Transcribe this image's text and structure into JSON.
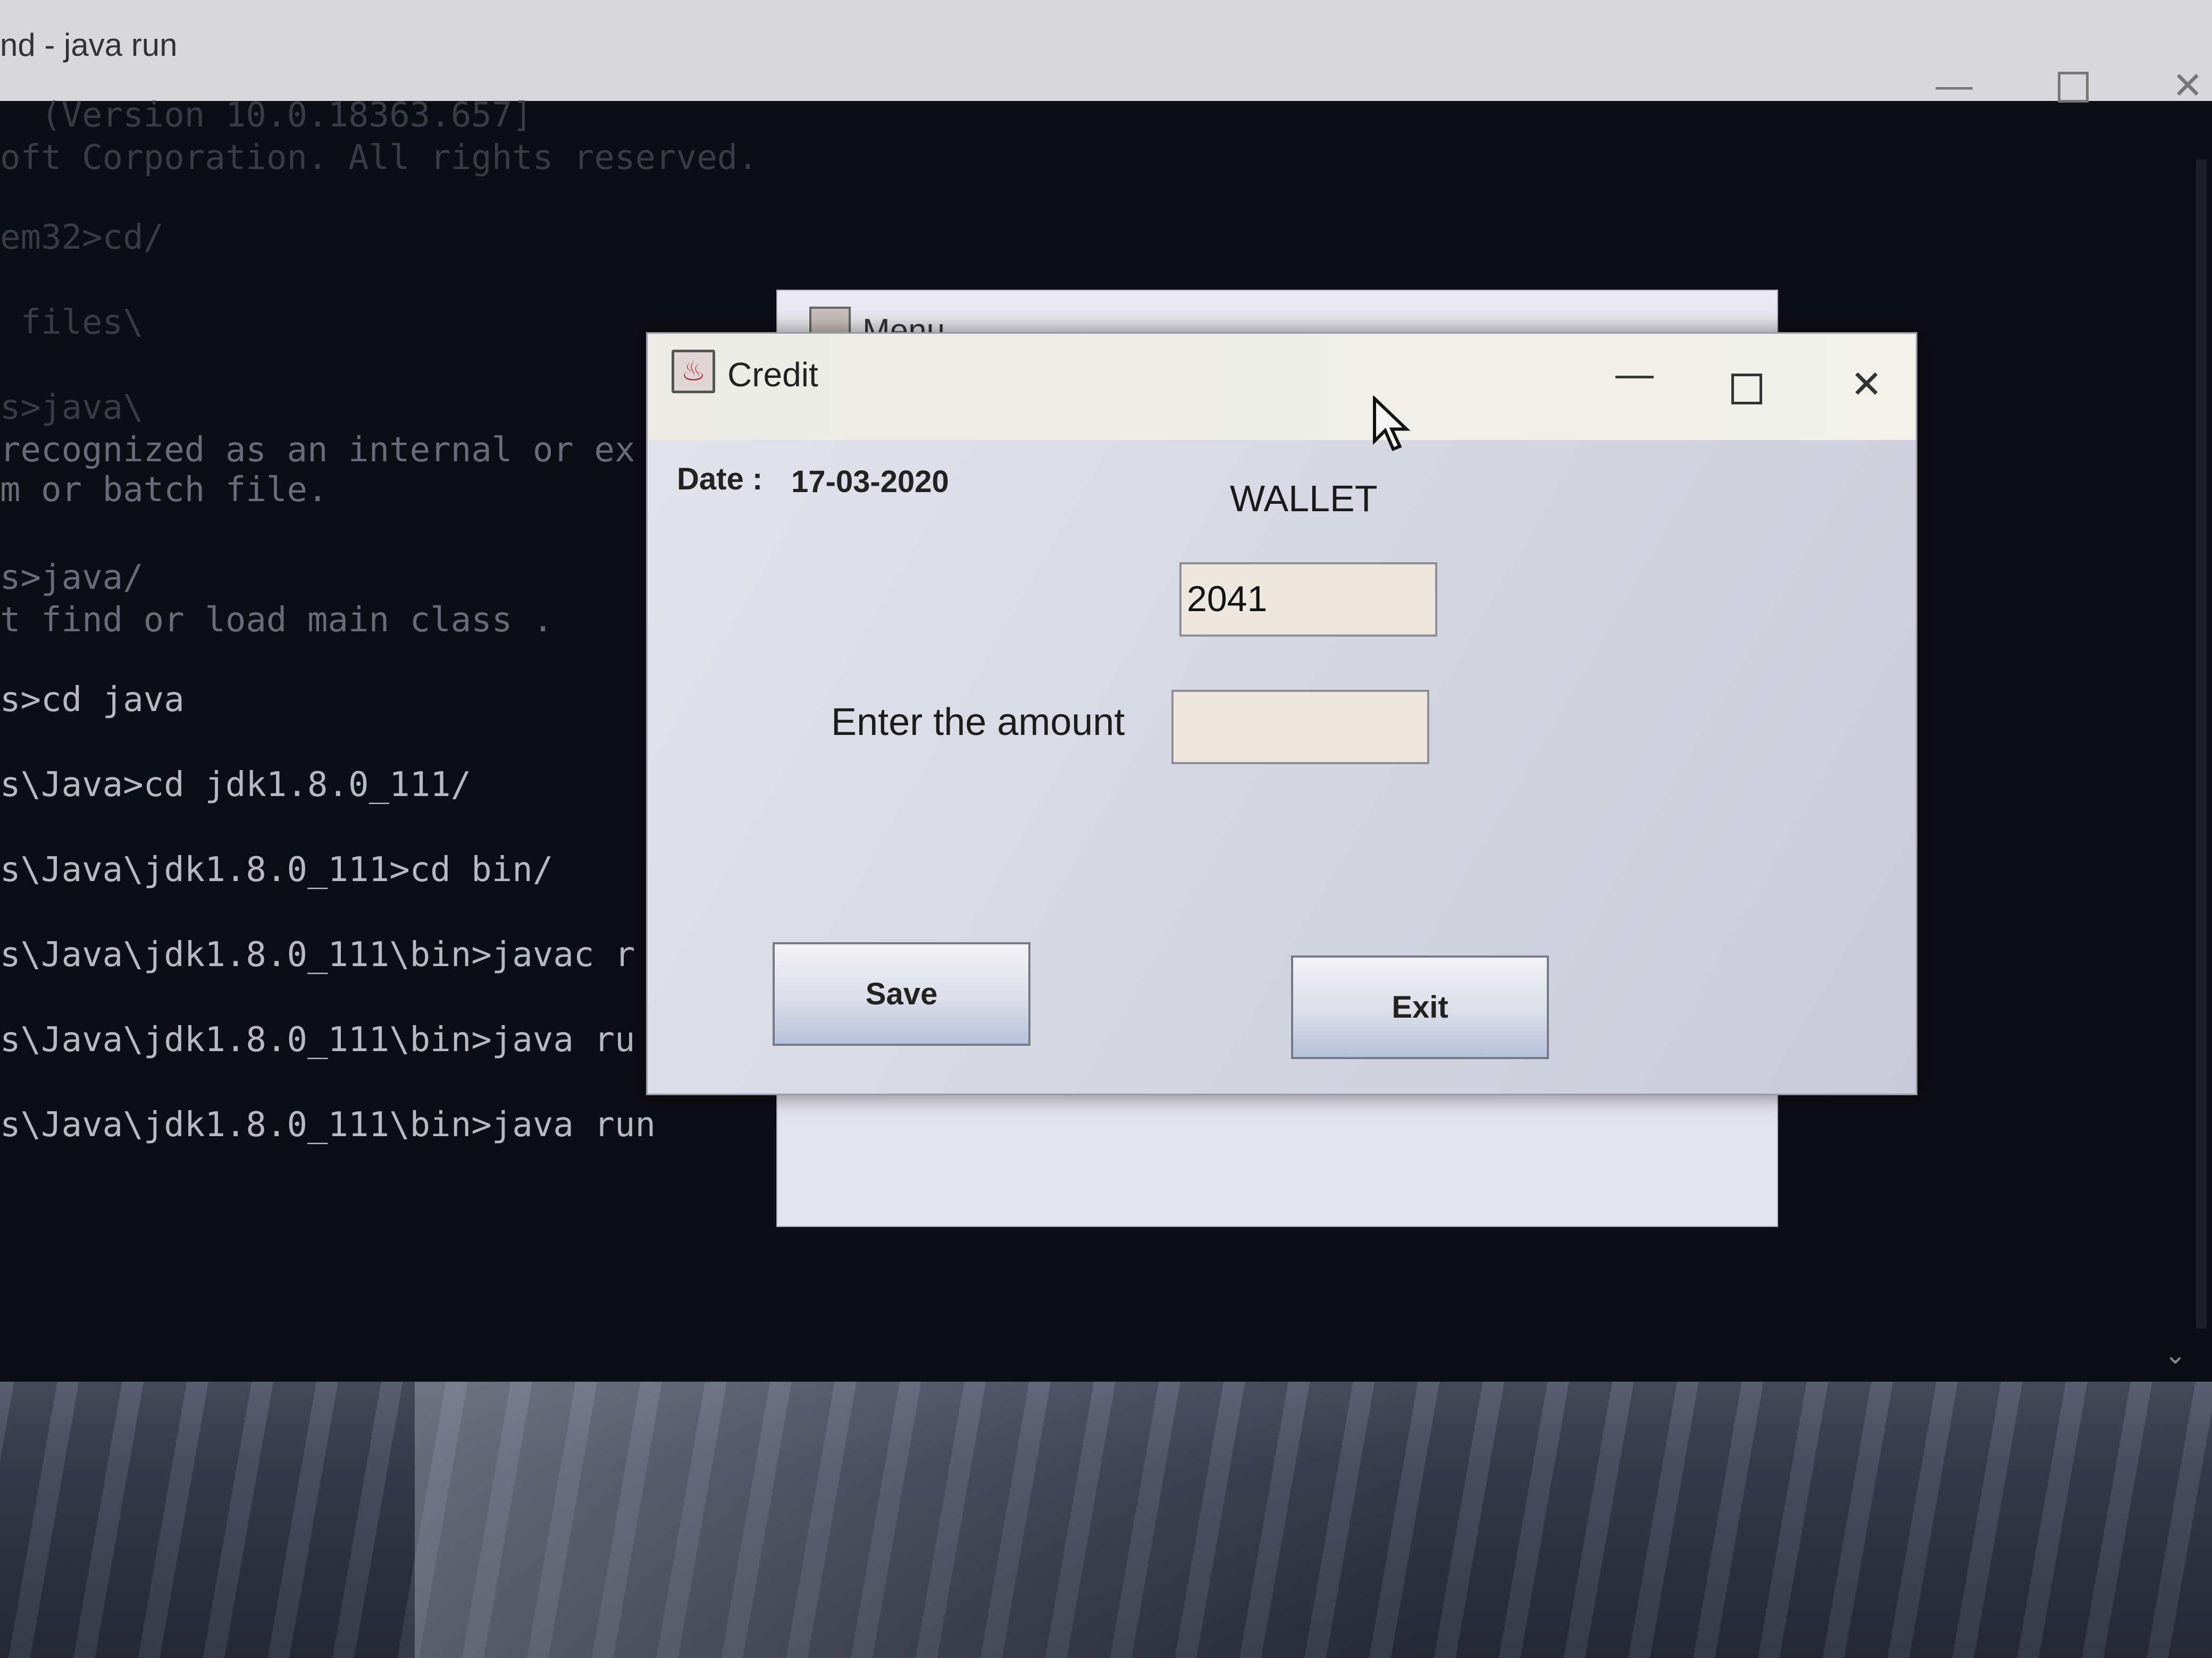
{
  "console": {
    "title": "nd - java  run",
    "lines": [
      "  (Version 10.0.18363.657]",
      "oft Corporation. All rights reserved.",
      "em32>cd/",
      " files\\",
      "s>java\\",
      "recognized as an internal or ex",
      "m or batch file.",
      "s>java/",
      "t find or load main class .",
      "s>cd java",
      "s\\Java>cd jdk1.8.0_111/",
      "s\\Java\\jdk1.8.0_111>cd bin/",
      "s\\Java\\jdk1.8.0_111\\bin>javac r",
      "s\\Java\\jdk1.8.0_111\\bin>java ru",
      "s\\Java\\jdk1.8.0_111\\bin>java run"
    ]
  },
  "menu_window": {
    "title": "Menu"
  },
  "credit_window": {
    "title": "Credit",
    "date_label": "Date :",
    "date_value": "17-03-2020",
    "heading": "WALLET",
    "wallet_value": "2041",
    "amount_label": "Enter the amount",
    "amount_value": "",
    "save_label": "Save",
    "exit_label": "Exit"
  }
}
